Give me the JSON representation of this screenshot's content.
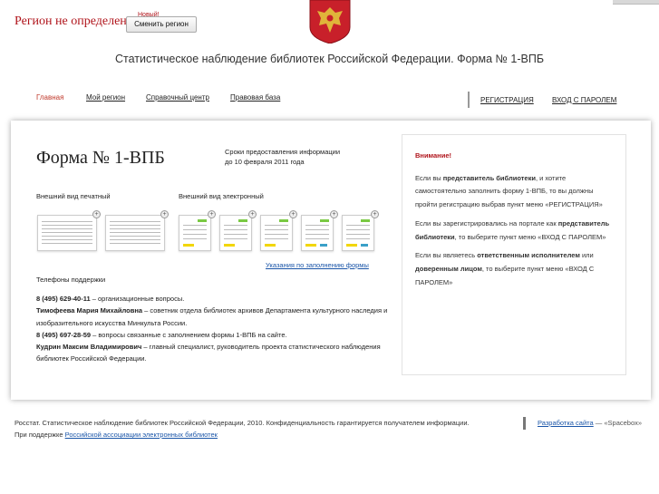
{
  "header": {
    "region_text": "Регион не определен",
    "region_tip": "Новый!",
    "change_region_button": "Сменить регион",
    "site_title": "Статистическое наблюдение библиотек Российской Федерации. Форма № 1-ВПБ"
  },
  "nav": {
    "items": [
      "Главная",
      "Мой регион",
      "Справочный центр",
      "Правовая база"
    ],
    "active_index": 0,
    "register": "РЕГИСТРАЦИЯ",
    "login": "ВХОД С ПАРОЛЕМ"
  },
  "main": {
    "form_title": "Форма № 1-ВПБ",
    "deadline_line1": "Сроки предоставления информации",
    "deadline_line2": "до 10 февраля 2011 года",
    "print_label": "Внешний вид печатный",
    "electronic_label": "Внешний вид электронный",
    "plus": "+",
    "guide_link": "Указания по заполнению формы",
    "phones_heading": "Телефоны поддержки",
    "phones": [
      {
        "bold": "8 (495) 629-40-11",
        "text": " – организационные вопросы."
      },
      {
        "bold": "Тимофеева Мария Михайловна",
        "text": " – советник отдела библиотек архивов Департамента культурного наследия и изобразительного искусства Минкульта России."
      },
      {
        "bold": "8 (495) 697-28-59",
        "text": " – вопросы связанные с заполнением формы 1-ВПБ на сайте."
      },
      {
        "bold": "Кудрин Максим Владимирович",
        "text": " – главный специалист, руководитель проекта статистического наблюдения библиотек Российской Федерации."
      }
    ]
  },
  "notice": {
    "heading": "Внимание!",
    "p1_a": "Если вы ",
    "p1_b": "представитель библиотеки",
    "p1_c": ", и хотите самостоятельно заполнить форму 1-ВПБ, то вы должны пройти регистрацию выбрав пункт меню «РЕГИСТРАЦИЯ»",
    "p2_a": "Если вы зарегистрировались на портале как ",
    "p2_b": "представитель библиотеки",
    "p2_c": ", то выберите пункт меню «ВХОД С ПАРОЛЕМ»",
    "p3_a": "Если вы являетесь ",
    "p3_b": "ответственным исполнителем",
    "p3_c": " или ",
    "p3_d": "доверенным лицом",
    "p3_e": ", то выберите пункт меню «ВХОД С ПАРОЛЕМ»"
  },
  "footer": {
    "line1": "Росстат. Статистическое наблюдение библиотек Российской Федерации, 2010. Конфиденциальность гарантируется получателем информации.",
    "line2_prefix": "При поддержке ",
    "line2_link": "Российской ассоциации электронных библиотек",
    "dev_link": "Разработка сайта",
    "dev_suffix": " — «Spacebox»"
  }
}
